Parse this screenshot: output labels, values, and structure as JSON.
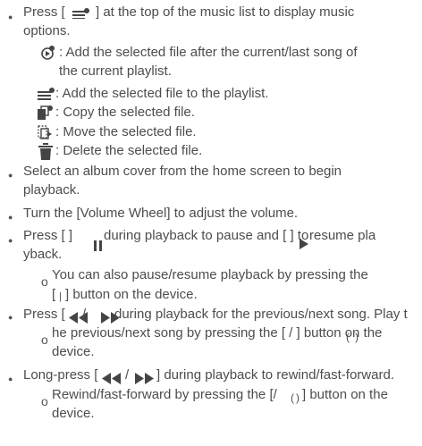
{
  "lines": {
    "l1a": "Press [",
    "l1b": "] at the top of the music list to display music",
    "l2": "options.",
    "l3": ": Add the selected file after the current/last song of",
    "l4": "the current playlist.",
    "l5": ": Add the selected file to the playlist.",
    "l6": ": Copy the selected file.",
    "l7": ": Move the selected file.",
    "l8": ": Delete the selected file.",
    "l9": "Select an album cover from the home screen to begin",
    "l10": "playback.",
    "l11": "Turn the [Volume Wheel] to adjust the volume.",
    "l12a": "Press [ ]",
    "l12b": "during playback to pause and [ ] to",
    "l12c": "resume  pla",
    "l13": "yback.",
    "l14": "You can also pause/resume playback by pressing the",
    "l15a": "[",
    "l15b": "] button on the device.",
    "l16a": "Press [",
    "l16b": "during playback for the previous/next song.  Play t",
    "l17": "he previous/next song by pressing the [ / ] button  on the",
    "l18": "device.",
    "l19a": "Long-press [",
    "l19b": "/",
    "l19c": "] during playback to rewind/fast-forward.",
    "l20": "Rewind/fast-forward by pressing the [/",
    "l20b": "] button on  the",
    "l21": "device."
  },
  "marks": {
    "bullet": "●",
    "sub_bullet": "o",
    "slash": "/",
    "pipe": "|",
    "paren_l": "(",
    "paren_r": ")"
  }
}
